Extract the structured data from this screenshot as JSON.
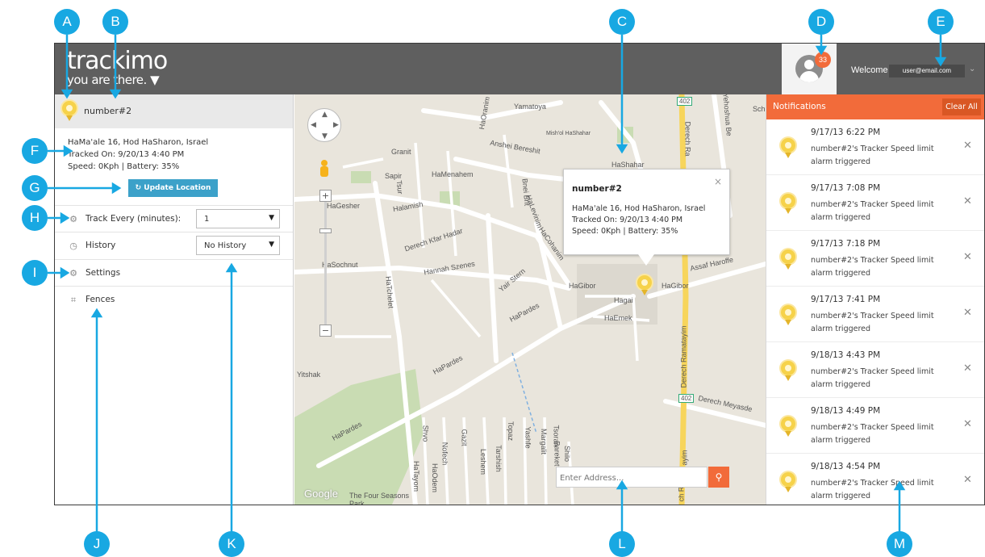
{
  "header": {
    "brand": "trackimo",
    "tagline": "you are there.",
    "notification_count": "33",
    "welcome": "Welcome",
    "user_email": "user@email.com"
  },
  "left_panel": {
    "tracker_name": "number#2",
    "address": "HaMa'ale 16, Hod HaSharon, Israel",
    "tracked_on": "Tracked On: 9/20/13 4:40 PM",
    "speed_battery": "Speed: 0Kph | Battery: 35%",
    "update_button": "Update Location",
    "track_every_label": "Track Every (minutes):",
    "track_every_value": "1",
    "history_label": "History",
    "history_value": "No History",
    "settings_label": "Settings",
    "fences_label": "Fences"
  },
  "map": {
    "streets": [
      "Yamatoya",
      "Granit",
      "Anshei Bereshit",
      "Sapir",
      "HaMenahem",
      "HaGesher",
      "Halamish",
      "Derech Kfar Hadar",
      "HaSochnut",
      "Hannah Szenes",
      "Yair Stern",
      "HaGibor",
      "Hagai",
      "HaEmek",
      "Derech Ramatayim",
      "Derech Meyasde",
      "Assaf Haroffe",
      "HaShahar",
      "HaPardes",
      "HaPardes",
      "HaPardes",
      "Yitshak",
      "HaTchelet",
      "Tsur",
      "Bnei Brit",
      "HaLevinim",
      "HaCohanim",
      "Shvo",
      "Nofech",
      "Gazit",
      "Leshem",
      "Tarshish",
      "Topaz",
      "Yashfe",
      "Margalit",
      "Tsoran",
      "Bareket",
      "HaTayom",
      "HaOdem",
      "The Four Seasons Park",
      "Mish'ol HaShahar",
      "Sch",
      "HaOranim",
      "Yehoshua Be",
      "Derech Ra",
      "Shilo",
      "HaGibor",
      "ch R",
      "ayim"
    ],
    "route_numbers": [
      "402",
      "402"
    ],
    "popup": {
      "title": "number#2",
      "address": "HaMa'ale 16, Hod HaSharon, Israel",
      "tracked_on": "Tracked On: 9/20/13 4:40 PM",
      "speed_battery": "Speed: 0Kph | Battery: 35%",
      "close": "×"
    },
    "search_placeholder": "Enter Address...",
    "google_logo": "Google"
  },
  "notifications": {
    "title": "Notifications",
    "clear_all": "Clear All",
    "items": [
      {
        "time": "9/17/13 6:22 PM",
        "text": "number#2's Tracker Speed limit alarm triggered"
      },
      {
        "time": "9/17/13 7:08 PM",
        "text": "number#2's Tracker Speed limit alarm triggered"
      },
      {
        "time": "9/17/13 7:18 PM",
        "text": "number#2's Tracker Speed limit alarm triggered"
      },
      {
        "time": "9/17/13 7:41 PM",
        "text": "number#2's Tracker Speed limit alarm triggered"
      },
      {
        "time": "9/18/13 4:43 PM",
        "text": "number#2's Tracker Speed limit alarm triggered"
      },
      {
        "time": "9/18/13 4:49 PM",
        "text": "number#2's Tracker Speed limit alarm triggered"
      },
      {
        "time": "9/18/13 4:54 PM",
        "text": "number#2's Tracker Speed limit alarm triggered"
      }
    ]
  },
  "callouts": [
    "A",
    "B",
    "C",
    "D",
    "E",
    "F",
    "G",
    "H",
    "I",
    "J",
    "K",
    "L",
    "M"
  ],
  "colors": {
    "header_bg": "#5f5f5f",
    "accent_orange": "#f26b3a",
    "button_blue": "#3ca1c9",
    "callout_blue": "#18a8e2",
    "bulb_yellow": "#f6d24a"
  },
  "icons": {
    "tracker": "lightbulb-pin-icon",
    "refresh": "refresh-icon",
    "track_every": "gear-icon",
    "history": "clock-icon",
    "settings": "gear-icon",
    "fences": "fence-icon",
    "search": "search-icon",
    "close": "close-icon",
    "dropdown": "chevron-down-icon"
  }
}
